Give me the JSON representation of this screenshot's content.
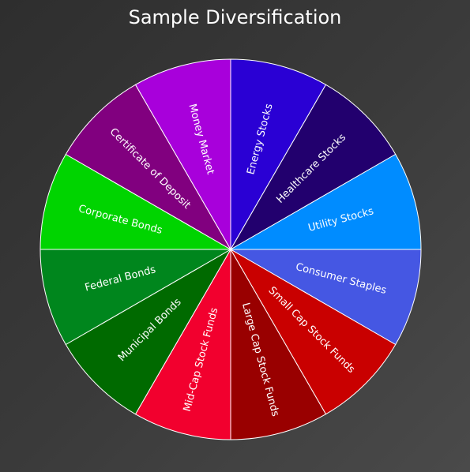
{
  "chart_data": {
    "type": "pie",
    "title": "Sample Diversification",
    "slices": [
      {
        "label": "Energy Stocks",
        "value": 1,
        "color": "#2a00d4"
      },
      {
        "label": "Healthcare Stocks",
        "value": 1,
        "color": "#22006e"
      },
      {
        "label": "Utility Stocks",
        "value": 1,
        "color": "#008cff"
      },
      {
        "label": "Consumer Staples",
        "value": 1,
        "color": "#4557e3"
      },
      {
        "label": "Small Cap Stock Funds",
        "value": 1,
        "color": "#c90000"
      },
      {
        "label": "Large Cap Stock Funds",
        "value": 1,
        "color": "#990000"
      },
      {
        "label": "Mid-Cap Stock Funds",
        "value": 1,
        "color": "#f2002e"
      },
      {
        "label": "Municipal Bonds",
        "value": 1,
        "color": "#006a00"
      },
      {
        "label": "Federal Bonds",
        "value": 1,
        "color": "#00861d"
      },
      {
        "label": "Corporate Bonds",
        "value": 1,
        "color": "#00d400"
      },
      {
        "label": "Certificate of Deposit",
        "value": 1,
        "color": "#81007f"
      },
      {
        "label": "Money Market",
        "value": 1,
        "color": "#a800db"
      }
    ]
  }
}
